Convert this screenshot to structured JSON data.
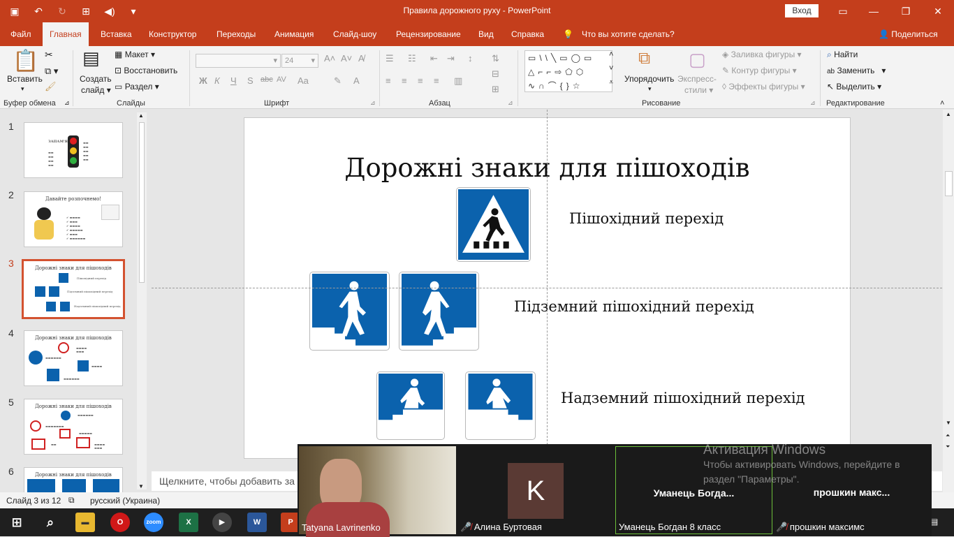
{
  "window": {
    "title": "Правила дорожного руху  -  PowerPoint",
    "signin": "Вход",
    "accent": "#c43e1c"
  },
  "tabs": [
    "Файл",
    "Главная",
    "Вставка",
    "Конструктор",
    "Переходы",
    "Анимация",
    "Слайд-шоу",
    "Рецензирование",
    "Вид",
    "Справка"
  ],
  "tell_me": "Что вы хотите сделать?",
  "share": "Поделиться",
  "ribbon": {
    "clipboard": {
      "paste": "Вставить",
      "label": "Буфер обмена"
    },
    "slides": {
      "new_slide_1": "Создать",
      "new_slide_2": "слайд",
      "layout": "Макет",
      "reset": "Восстановить",
      "section": "Раздел",
      "label": "Слайды"
    },
    "font": {
      "size": "24",
      "label": "Шрифт",
      "bold": "Ж",
      "italic": "К",
      "underline": "Ч",
      "strike": "S",
      "spacing": "AV",
      "case": "Aa",
      "color": "A"
    },
    "paragraph": {
      "label": "Абзац"
    },
    "drawing": {
      "arrange_1": "Упорядочить",
      "quick_1": "Экспресс-",
      "quick_2": "стили",
      "fill": "Заливка фигуры",
      "outline": "Контур фигуры",
      "effects": "Эффекты фигуры",
      "label": "Рисование"
    },
    "editing": {
      "find": "Найти",
      "replace": "Заменить",
      "select": "Выделить",
      "label": "Редактирование"
    }
  },
  "thumbnails": [
    {
      "num": "1",
      "title": "ЗАПАМ'ЯТАЙ!"
    },
    {
      "num": "2",
      "title": "Давайте розпочнемо!"
    },
    {
      "num": "3",
      "title": "Дорожні знаки для пішоходів"
    },
    {
      "num": "4",
      "title": "Дорожні знаки для пішоходів"
    },
    {
      "num": "5",
      "title": "Дорожні знаки для пішоходів"
    },
    {
      "num": "6",
      "title": "Дорожні знаки для пішоходів"
    }
  ],
  "slide": {
    "title": "Дорожні знаки для пішоходів",
    "label_1": "Пішохідний перехід",
    "label_2": "Підземний пішохідний перехід",
    "label_3": "Надземний пішохідний перехід",
    "sign_color": "#0b62ad"
  },
  "notes_placeholder": "Щелкните, чтобы добавить за",
  "status": {
    "slide": "Слайд 3 из 12",
    "language": "русский (Украина)"
  },
  "zoom_call": {
    "participants": [
      {
        "name": "Tatyana Lavrinenko",
        "big": ""
      },
      {
        "name": "Алина Буртовая",
        "big": "K"
      },
      {
        "name": "Уманець Богдан 8 класс",
        "big": "Уманець  Богда..."
      },
      {
        "name": "прошкин максимс",
        "big": "прошкин  макс..."
      }
    ]
  },
  "activation": {
    "line1": "Активация Windows",
    "line2": "Чтобы активировать Windows, перейдите в",
    "line3": "раздел \"Параметры\"."
  },
  "taskbar": {
    "zoom": "zoom",
    "excel": "X",
    "word": "W",
    "powerpoint": "P"
  }
}
